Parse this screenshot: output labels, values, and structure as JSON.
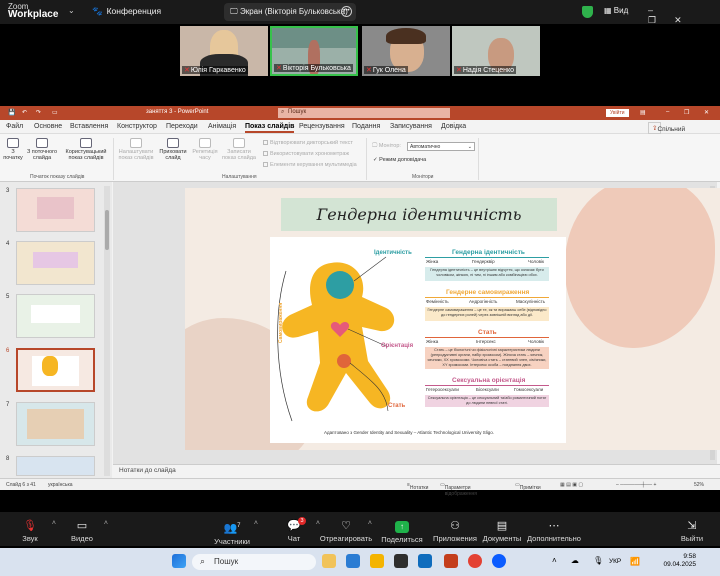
{
  "zoom": {
    "app_name": "Zoom",
    "app_product": "Workplace",
    "meeting": "Конференция",
    "share_label": "Экран (Вікторія Бульковська)",
    "view": "Вид",
    "participants": [
      "Юлія Гаркавенко",
      "Вікторія Бульковська",
      "Гук Олена",
      "Надія Стеценко"
    ],
    "toolbar": {
      "audio": "Звук",
      "video": "Видео",
      "participants": "Участники",
      "participants_count": "7",
      "chat": "Чат",
      "chat_badge": "3",
      "react": "Отреагировать",
      "share": "Поделиться",
      "apps": "Приложения",
      "docs": "Документы",
      "more": "Дополнительно",
      "leave": "Выйти"
    }
  },
  "ppt": {
    "title": "заняття 3 - PowerPoint",
    "search": "Пошук",
    "signin": "Увійти",
    "menu": [
      "Файл",
      "Основне",
      "Вставлення",
      "Конструктор",
      "Переходи",
      "Анімація",
      "Показ слайдів",
      "Рецензування",
      "Подання",
      "Записування",
      "Довідка"
    ],
    "menu_active": "Показ слайдів",
    "shared_access": "Спільний доступ",
    "ribbon": {
      "from_start": "З початку",
      "from_current": "З поточного слайда",
      "custom_show": "Користувацький показ слайдів",
      "group_start": "Початок показу слайдів",
      "setup_show": "Налаштувати показ слайдів",
      "hide_slide": "Приховати слайд",
      "rehearse": "Репетиція часу",
      "record": "Записати показ слайда",
      "cb_narr": "Відтворювати дикторський текст",
      "cb_timings": "Використовувати хронометраж",
      "cb_controls": "Елементи керування мультимедіа",
      "group_setup": "Налаштування",
      "monitor": "Монітор:",
      "monitor_value": "Автоматично",
      "presenter_view": "Режим доповідача",
      "group_monitors": "Монітори"
    },
    "thumb_numbers": [
      "3",
      "4",
      "5",
      "6",
      "7",
      "8"
    ],
    "notes": "Нотатки до слайда",
    "status": {
      "slide": "Слайд 6 з 41",
      "lang": "українська",
      "notes": "Нотатки",
      "display": "Параметри відображення",
      "comments": "Примітки",
      "zoom": "52%"
    }
  },
  "slide": {
    "title": "Гендерна ідентичність",
    "labels": {
      "identity": "Ідентичність",
      "expression": "Самовираження",
      "orientation": "Орієнтація",
      "sex": "Стать"
    },
    "sections": [
      {
        "heading": "Гендерна ідентичність",
        "color": "#2d9ea3",
        "items": [
          "Жінка",
          "Гендерквір",
          "Чоловік"
        ],
        "text": "Гендерна ідентичність – це внутрішнє відчуття, що означає бути чоловіком, жінкою, ні тим, ні іншим або комбінацією обох."
      },
      {
        "heading": "Гендерне самовираження",
        "color": "#f0a838",
        "items": [
          "Фемінність",
          "Андрогінність",
          "Маскулінність"
        ],
        "text": "Гендерне самовираження – це те, як ти виражаєш себе (відповідно до гендерних ролей) через зовнішній вигляд або дії."
      },
      {
        "heading": "Стать",
        "color": "#e0653a",
        "items": [
          "Жінка",
          "Інтерсекс",
          "Чоловік"
        ],
        "text": "Стать – це біологічні чи фізіологічні характеристики людини (репродуктивні органи, набір хромосом). Жіноча стать – яєчник, яєчники, XX хромосоми. Чоловіча стать – статевий член, сім'яники, XY хромосоми. Інтерсекс особа – поєднання двох."
      },
      {
        "heading": "Сексуальна орієнтація",
        "color": "#c45a8c",
        "items": [
          "Гетеросексуали",
          "Бісексуали",
          "Гомосексуали"
        ],
        "text": "Сексуальна орієнтація – це сексуальний та/або романтичний потяг до людини певної статі."
      }
    ],
    "citation": "Адаптовано з Gender Identity and Sexuality – Atlantic Technological University Sligo."
  },
  "taskbar": {
    "search": "Пошук",
    "lang": "УКР",
    "time": "9:58",
    "date": "09.04.2025"
  },
  "colors": {
    "ppt_accent": "#b7472a",
    "zoom_bg": "#1a1a1a",
    "share_green": "#1fb24a"
  }
}
